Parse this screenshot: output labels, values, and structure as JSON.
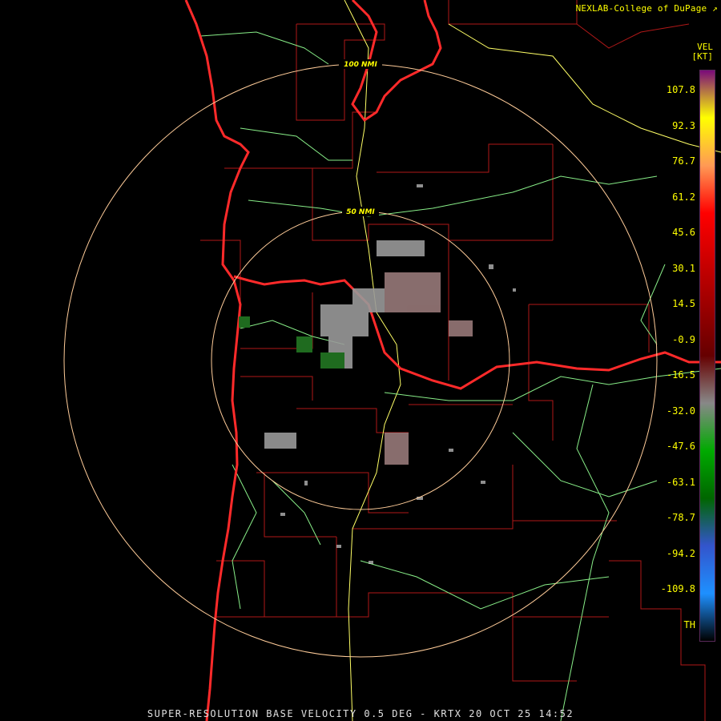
{
  "credit": "NEXLAB-College of DuPage",
  "credit_icon": "external-link-icon",
  "product": "VEL",
  "units": "[KT]",
  "footer": "SUPER-RESOLUTION BASE VELOCITY 0.5 DEG - KRTX 20 OCT 25 14:52",
  "rings": [
    {
      "label": "100 NMI"
    },
    {
      "label": "50 NMI"
    }
  ],
  "legend": {
    "ticks": [
      "107.8",
      "92.3",
      "76.7",
      "61.2",
      "45.6",
      "30.1",
      "14.5",
      "-0.9",
      "-16.5",
      "-32.0",
      "-47.6",
      "-63.1",
      "-78.7",
      "-94.2",
      "-109.8",
      "TH"
    ],
    "colors": [
      "#7a0a7a",
      "#ffff00",
      "#ff9955",
      "#ff0000",
      "#cc0000",
      "#990000",
      "#660000",
      "#888888",
      "#00aa00",
      "#006600",
      "#3355cc",
      "#1e90ff",
      "#000000"
    ]
  },
  "colors": {
    "state_border": "#ff2a2a",
    "county_border": "#b01818",
    "highway": "#ffff66",
    "road": "#88ee88",
    "ring": "#ffcc99"
  }
}
